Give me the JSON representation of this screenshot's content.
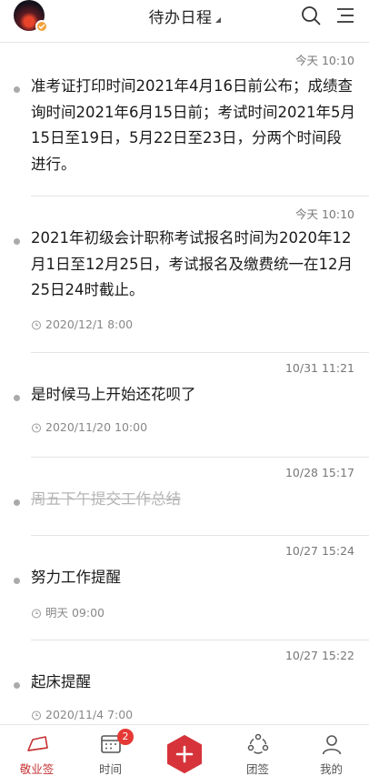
{
  "header": {
    "title": "待办日程",
    "icons": {
      "avatar": "avatar-image",
      "search": "search-icon",
      "menu": "menu-icon"
    }
  },
  "items": [
    {
      "time": "今天 10:10",
      "text": "准考证打印时间2021年4月16日前公布；成绩查询时间2021年6月15日前；考试时间2021年5月15日至19日，5月22日至23日，分两个时间段进行。",
      "reminder": "",
      "done": false
    },
    {
      "time": "今天 10:10",
      "text": "2021年初级会计职称考试报名时间为2020年12月1日至12月25日，考试报名及缴费统一在12月25日24时截止。",
      "reminder": "2020/12/1 8:00",
      "done": false
    },
    {
      "time": "10/31 11:21",
      "text": "是时候马上开始还花呗了",
      "reminder": "2020/11/20 10:00",
      "done": false
    },
    {
      "time": "10/28 15:17",
      "text": "周五下午提交工作总结",
      "reminder": "",
      "done": true
    },
    {
      "time": "10/27 15:24",
      "text": "努力工作提醒",
      "reminder": "明天 09:00",
      "done": false
    },
    {
      "time": "10/27 15:22",
      "text": "起床提醒",
      "reminder": "2020/11/4 7:00",
      "done": false
    }
  ],
  "tabbar": {
    "tabs": [
      {
        "label": "敬业签",
        "icon": "notes-icon",
        "active": true
      },
      {
        "label": "时间",
        "icon": "calendar-icon",
        "badge": "2"
      },
      {
        "label": "",
        "icon": "add-icon"
      },
      {
        "label": "团签",
        "icon": "team-icon"
      },
      {
        "label": "我的",
        "icon": "profile-icon"
      }
    ]
  },
  "colors": {
    "accent": "#c53030",
    "badge": "#e53935",
    "fab": "#d6333a"
  }
}
